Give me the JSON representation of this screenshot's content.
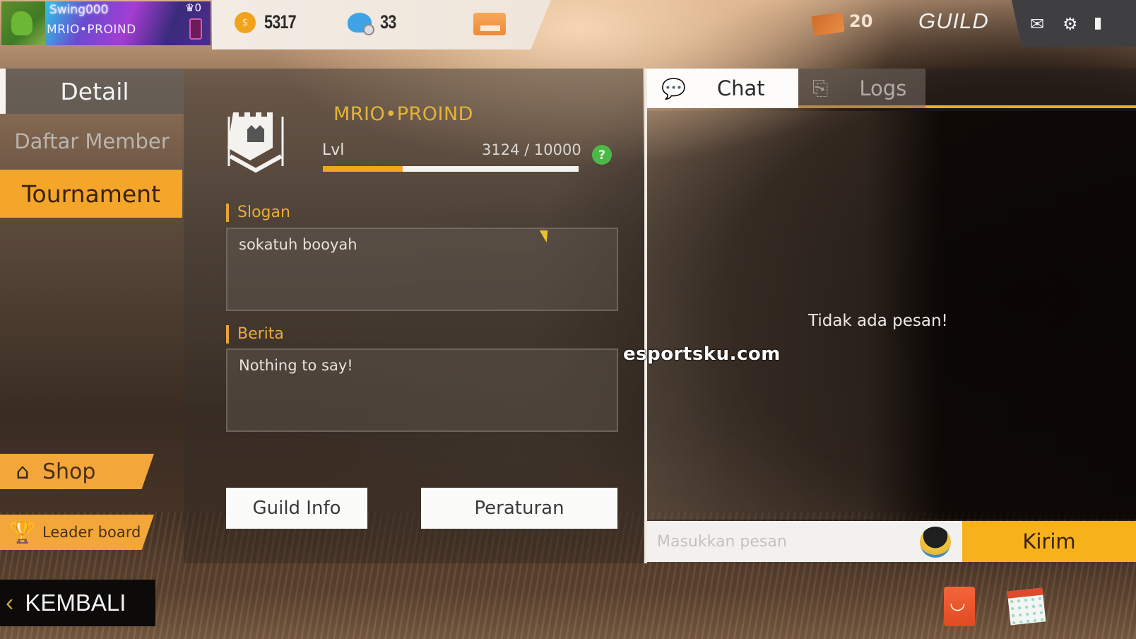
{
  "header": {
    "player_name": "Swing000",
    "player_guild_tag": "MRIO•PROIND",
    "rank_badge": "0",
    "coins": "5317",
    "diamonds": "33",
    "tickets": "20",
    "screen_title": "GUILD",
    "icons": [
      "avatar",
      "coin-icon",
      "diamond-icon",
      "card-icon",
      "ticket-icon",
      "mail-icon",
      "gear-icon",
      "battery-icon"
    ]
  },
  "sidebar": {
    "items": [
      {
        "label": "Detail",
        "active": true
      },
      {
        "label": "Daftar Member",
        "active": false
      },
      {
        "label": "Tournament",
        "highlight": true
      }
    ],
    "shop_label": "Shop",
    "leaderboard_label": "Leader board",
    "back_label": "KEMBALI"
  },
  "guild": {
    "name": "MRIO•PROIND",
    "level_label": "Lvl",
    "xp_current": 3124,
    "xp_max": 10000,
    "xp_text": "3124 / 10000",
    "xp_progress": 0.3124,
    "help_glyph": "?",
    "slogan_label": "Slogan",
    "slogan": "sokatuh booyah",
    "berita_label": "Berita",
    "berita": "Nothing to say!",
    "guild_info_button": "Guild Info",
    "rules_button": "Peraturan"
  },
  "chat": {
    "tabs": [
      {
        "label": "Chat",
        "active": true
      },
      {
        "label": "Logs",
        "active": false
      }
    ],
    "empty_message": "Tidak ada pesan!",
    "input_placeholder": "Masukkan pesan",
    "send_label": "Kirim"
  },
  "watermark": "esportsku.com",
  "colors": {
    "accent": "#f4a62a",
    "guild_name": "#e3b33a",
    "progress": "#f2a71f",
    "help": "#4db848"
  }
}
